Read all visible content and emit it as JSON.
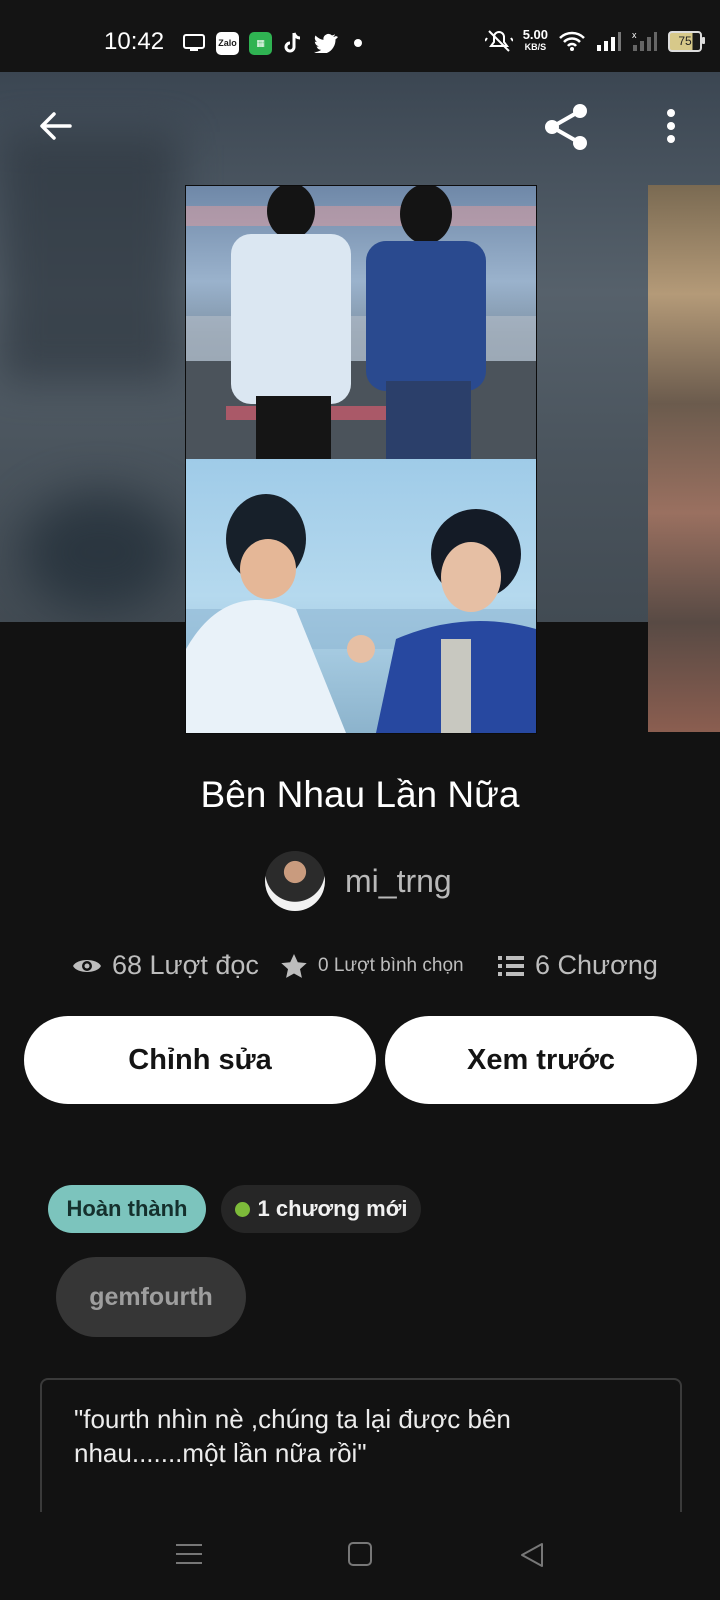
{
  "status_bar": {
    "time": "10:42",
    "speed_value": "5.00",
    "speed_unit": "KB/S",
    "battery": "75",
    "app_icons": [
      "monitor-icon",
      "zalo-icon",
      "calculator-icon",
      "tiktok-icon",
      "twitter-icon",
      "dot-icon"
    ],
    "zalo_label": "Zalo"
  },
  "story": {
    "title": "Bên Nhau Lần Nữa",
    "author": "mi_trng",
    "stats": {
      "reads": "68 Lượt đọc",
      "votes": "0 Lượt bình chọn",
      "chapters": "6 Chương"
    },
    "buttons": {
      "edit": "Chỉnh sửa",
      "preview": "Xem trước"
    },
    "status_badge": "Hoàn thành",
    "new_chapter_badge": "1 chương mới",
    "tag": "gemfourth",
    "description_line1": "\"fourth nhìn nè ,chúng ta lại được bên",
    "description_line2": "nhau.......một lần nữa rồi\""
  },
  "colors": {
    "background": "#121212",
    "badge_complete": "#7cc4bd",
    "new_dot": "#7dbb3a"
  }
}
